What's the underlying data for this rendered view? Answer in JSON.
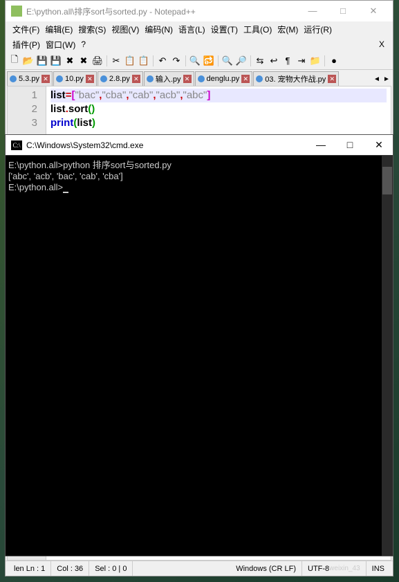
{
  "notepadpp": {
    "title": "E:\\python.all\\排序sort与sorted.py - Notepad++",
    "window_buttons": {
      "min": "—",
      "max": "□",
      "close": "✕"
    },
    "menu": {
      "row1": [
        "文件(F)",
        "编辑(E)",
        "搜索(S)",
        "视图(V)",
        "编码(N)",
        "语言(L)",
        "设置(T)",
        "工具(O)",
        "宏(M)",
        "运行(R)"
      ],
      "row2": [
        "插件(P)",
        "窗口(W)",
        "?"
      ],
      "extra_x": "X"
    },
    "toolbar_icons": [
      {
        "name": "new-file-icon",
        "g": "🗋"
      },
      {
        "name": "open-icon",
        "g": "📂"
      },
      {
        "name": "save-icon",
        "g": "💾"
      },
      {
        "name": "save-all-icon",
        "g": "💾"
      },
      {
        "name": "close-icon",
        "g": "✖"
      },
      {
        "name": "close-all-icon",
        "g": "✖"
      },
      {
        "name": "print-icon",
        "g": "🖨"
      },
      {
        "sep": true
      },
      {
        "name": "cut-icon",
        "g": "✂"
      },
      {
        "name": "copy-icon",
        "g": "📋"
      },
      {
        "name": "paste-icon",
        "g": "📋"
      },
      {
        "sep": true
      },
      {
        "name": "undo-icon",
        "g": "↶"
      },
      {
        "name": "redo-icon",
        "g": "↷"
      },
      {
        "sep": true
      },
      {
        "name": "find-icon",
        "g": "🔍"
      },
      {
        "name": "replace-icon",
        "g": "🔂"
      },
      {
        "sep": true
      },
      {
        "name": "zoom-in-icon",
        "g": "🔍"
      },
      {
        "name": "zoom-out-icon",
        "g": "🔎"
      },
      {
        "sep": true
      },
      {
        "name": "sync-icon",
        "g": "⇆"
      },
      {
        "name": "wrap-icon",
        "g": "↩"
      },
      {
        "name": "all-chars-icon",
        "g": "¶"
      },
      {
        "name": "indent-icon",
        "g": "⇥"
      },
      {
        "name": "folder-icon",
        "g": "📁"
      },
      {
        "sep": true
      },
      {
        "name": "record-icon",
        "g": "●"
      }
    ],
    "tabs": [
      {
        "label": "5.3.py",
        "active": false
      },
      {
        "label": "10.py",
        "active": false
      },
      {
        "label": "2.8.py",
        "active": false
      },
      {
        "label": "输入.py",
        "active": false
      },
      {
        "label": "denglu.py",
        "active": false
      },
      {
        "label": "03. 宠物大作战.py",
        "active": false
      }
    ],
    "tab_arrows": {
      "left": "◄",
      "right": "►"
    },
    "code": {
      "lines": [
        {
          "n": "1",
          "highlight": true,
          "tokens": [
            [
              "ident",
              "list"
            ],
            [
              "op",
              "="
            ],
            [
              "br1",
              "["
            ],
            [
              "str",
              "\"bac\""
            ],
            [
              "op",
              ","
            ],
            [
              "str",
              "\"cba\""
            ],
            [
              "op",
              ","
            ],
            [
              "str",
              "\"cab\""
            ],
            [
              "op",
              ","
            ],
            [
              "str",
              "\"acb\""
            ],
            [
              "op",
              ","
            ],
            [
              "str",
              "\"abc\""
            ],
            [
              "br1",
              "]"
            ]
          ]
        },
        {
          "n": "2",
          "tokens": [
            [
              "ident",
              "list"
            ],
            [
              "op",
              "."
            ],
            [
              "ident",
              "sort"
            ],
            [
              "br2",
              "("
            ],
            [
              "br2",
              ")"
            ]
          ]
        },
        {
          "n": "3",
          "tokens": [
            [
              "kw",
              "print"
            ],
            [
              "br2",
              "("
            ],
            [
              "ident",
              "list"
            ],
            [
              "br2",
              ")"
            ]
          ]
        }
      ]
    },
    "status": {
      "len_ln": "len   Ln : 1",
      "col": "Col : 36",
      "sel": "Sel : 0 | 0",
      "eol": "Windows (CR LF)",
      "enc": "UTF-8",
      "ins": "INS",
      "watermark": "weixin_43"
    }
  },
  "cmd": {
    "title": "C:\\Windows\\System32\\cmd.exe",
    "window_buttons": {
      "min": "—",
      "max": "□",
      "close": "✕"
    },
    "lines": [
      "",
      "E:\\python.all>python 排序sort与sorted.py",
      "['abc', 'acb', 'bac', 'cab', 'cba']",
      "",
      "E:\\python.all>"
    ],
    "icon_text": "C:\\"
  }
}
